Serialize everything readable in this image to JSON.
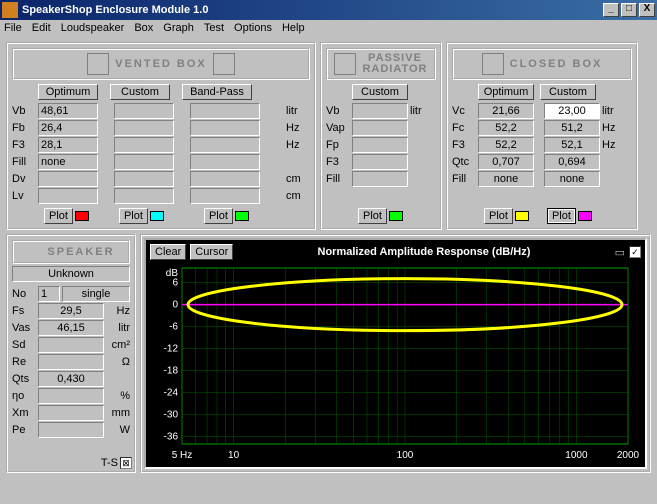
{
  "window": {
    "title": "SpeakerShop Enclosure Module 1.0",
    "min": "_",
    "max": "□",
    "close": "X"
  },
  "menu": [
    "File",
    "Edit",
    "Loudspeaker",
    "Box",
    "Graph",
    "Test",
    "Options",
    "Help"
  ],
  "vented": {
    "title": "VENTED BOX",
    "cols": {
      "opt": "Optimum",
      "cust": "Custom",
      "bp": "Band-Pass"
    },
    "rows": [
      {
        "lbl": "Vb",
        "opt": "48,61",
        "unit": "litr"
      },
      {
        "lbl": "Fb",
        "opt": "26,4",
        "unit": "Hz"
      },
      {
        "lbl": "F3",
        "opt": "28,1",
        "unit": "Hz"
      },
      {
        "lbl": "Fill",
        "opt": "none",
        "unit": ""
      },
      {
        "lbl": "Dv",
        "opt": "",
        "unit": "cm"
      },
      {
        "lbl": "Lv",
        "opt": "",
        "unit": "cm"
      }
    ],
    "plot": "Plot",
    "swatches": [
      "#ff0000",
      "#00ffff",
      "#00ff00"
    ]
  },
  "passive": {
    "title": "PASSIVE RADIATOR",
    "cust": "Custom",
    "rows": [
      {
        "lbl": "Vb",
        "unit": "litr"
      },
      {
        "lbl": "Vap",
        "unit": ""
      },
      {
        "lbl": "Fp",
        "unit": ""
      },
      {
        "lbl": "F3",
        "unit": ""
      },
      {
        "lbl": "Fill",
        "unit": ""
      }
    ],
    "plot": "Plot",
    "swatch": "#00ff00"
  },
  "closed": {
    "title": "CLOSED BOX",
    "cols": {
      "opt": "Optimum",
      "cust": "Custom"
    },
    "rows": [
      {
        "lbl": "Vc",
        "opt": "21,66",
        "cust": "23,00",
        "unit": "litr"
      },
      {
        "lbl": "Fc",
        "opt": "52,2",
        "cust": "51,2",
        "unit": "Hz"
      },
      {
        "lbl": "F3",
        "opt": "52,2",
        "cust": "52,1",
        "unit": "Hz"
      },
      {
        "lbl": "Qtc",
        "opt": "0,707",
        "cust": "0,694",
        "unit": ""
      },
      {
        "lbl": "Fill",
        "opt": "none",
        "cust": "none",
        "unit": ""
      }
    ],
    "plot": "Plot",
    "swatches": [
      "#ffff00",
      "#ff00ff"
    ]
  },
  "speaker": {
    "title": "SPEAKER",
    "name": "Unknown",
    "no_lbl": "No",
    "no_val": "1",
    "mode": "single",
    "rows": [
      {
        "lbl": "Fs",
        "val": "29,5",
        "unit": "Hz"
      },
      {
        "lbl": "Vas",
        "val": "46,15",
        "unit": "litr"
      },
      {
        "lbl": "Sd",
        "val": "",
        "unit": "cm²"
      },
      {
        "lbl": "Re",
        "val": "",
        "unit": "Ω"
      },
      {
        "lbl": "Qts",
        "val": "0,430",
        "unit": ""
      },
      {
        "lbl": "ηo",
        "val": "",
        "unit": "%"
      },
      {
        "lbl": "Xm",
        "val": "",
        "unit": "mm"
      },
      {
        "lbl": "Pe",
        "val": "",
        "unit": "W"
      }
    ],
    "ts": "T-S"
  },
  "chart": {
    "clear": "Clear",
    "cursor": "Cursor",
    "title": "Normalized Amplitude Response (dB/Hz)"
  },
  "chart_data": {
    "type": "line",
    "title": "Normalized Amplitude Response (dB/Hz)",
    "xlabel": "Hz",
    "ylabel": "dB",
    "x_scale": "log",
    "xlim": [
      5,
      2000
    ],
    "ylim": [
      -38,
      10
    ],
    "y_ticks": [
      6,
      0,
      -6,
      -12,
      -18,
      -24,
      -30,
      -36
    ],
    "x_ticks": [
      5,
      10,
      100,
      1000,
      2000
    ],
    "x_tick_labels": [
      "5 Hz",
      "10",
      "100",
      "1000",
      "2000"
    ],
    "series": [
      {
        "name": "closed-custom",
        "color": "#ff00ff",
        "x": [
          5,
          10,
          20,
          50,
          100,
          200,
          500,
          1000,
          2000
        ],
        "y": [
          0,
          0,
          0,
          0,
          0,
          0,
          0,
          0,
          0
        ]
      }
    ],
    "annotations": [
      {
        "type": "ellipse",
        "color": "#ffff00",
        "cx_hz": 100,
        "cy_db": 0,
        "note": "highlight around 0 dB line"
      }
    ]
  }
}
